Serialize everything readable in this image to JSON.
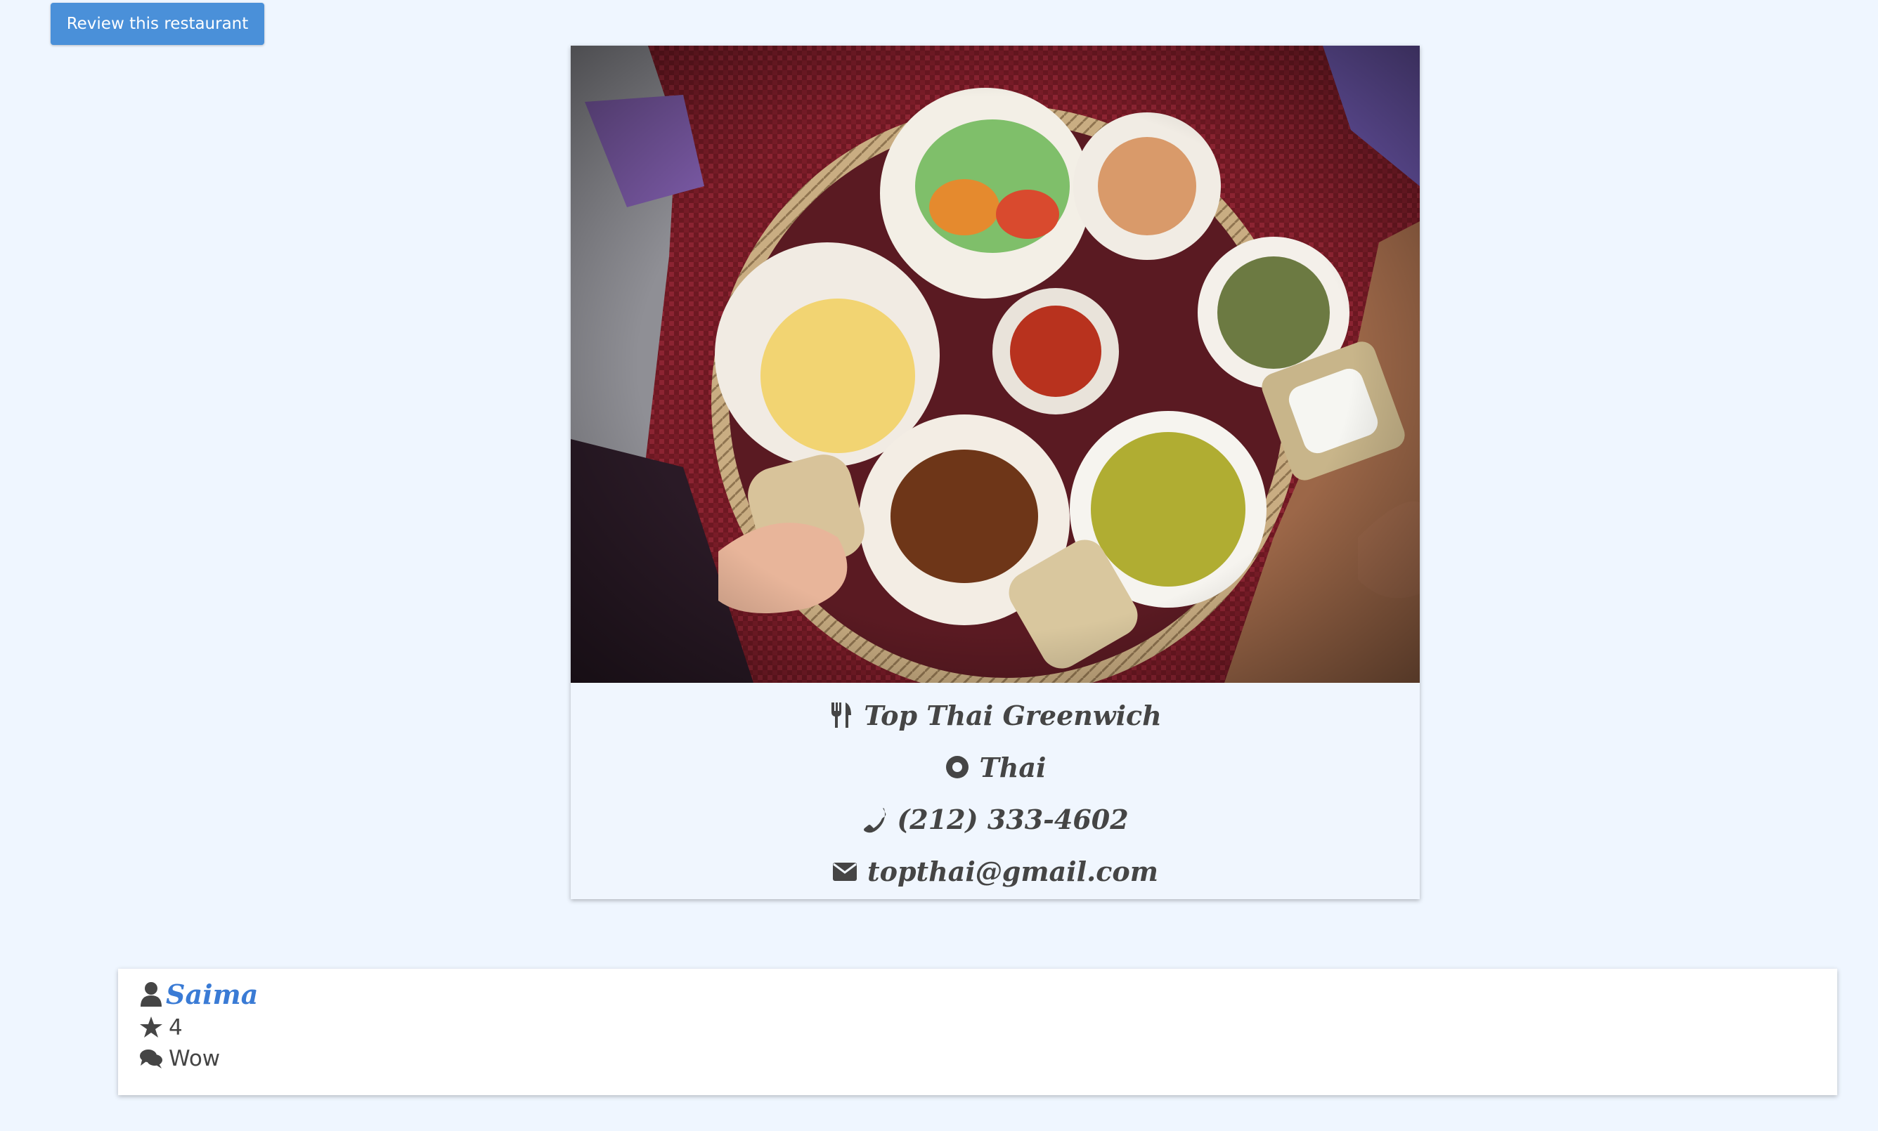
{
  "header": {
    "review_button_label": "Review this restaurant"
  },
  "restaurant": {
    "name": "Top Thai Greenwich",
    "cuisine": "Thai",
    "phone": "(212) 333-4602",
    "email": "topthai@gmail.com",
    "photo_icon": "thai-food-platter-photo"
  },
  "reviews": [
    {
      "author": "Saima",
      "rating": "4",
      "comment": "Wow"
    }
  ],
  "colors": {
    "background": "#eff6ff",
    "button": "#4a90d9",
    "link": "#3a7bd5",
    "text": "#454545"
  },
  "icons": {
    "name": "utensils-icon",
    "cuisine": "dot-circle-icon",
    "phone": "phone-icon",
    "email": "envelope-icon",
    "author": "user-icon",
    "rating": "star-icon",
    "comment": "comments-icon"
  }
}
